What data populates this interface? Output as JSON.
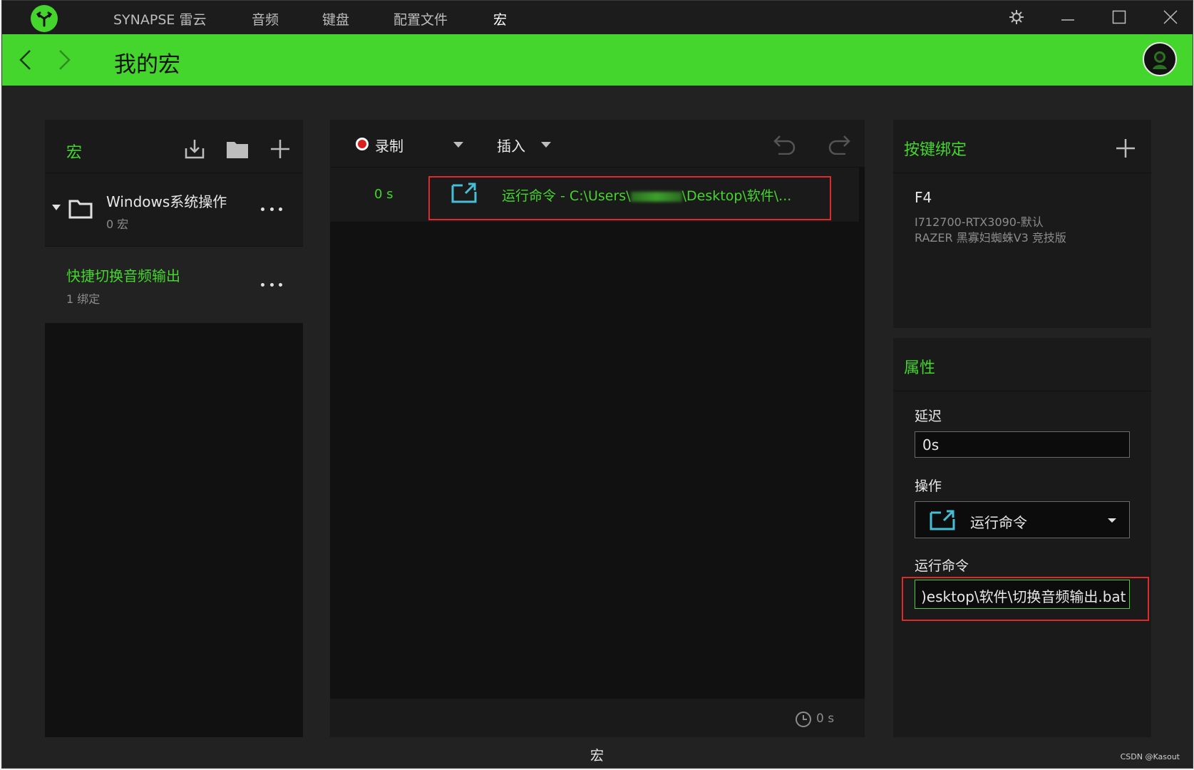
{
  "titlebar": {
    "nav": [
      "SYNAPSE 雷云",
      "音频",
      "键盘",
      "配置文件",
      "宏"
    ]
  },
  "header": {
    "title": "我的宏"
  },
  "macro_panel": {
    "title": "宏",
    "folder": {
      "name": "Windows系统操作",
      "count": "0 宏"
    },
    "macro": {
      "name": "快捷切换音频输出",
      "bindings": "1 绑定"
    }
  },
  "editor": {
    "record_label": "录制",
    "insert_label": "插入",
    "step": {
      "time": "0 s",
      "text_prefix": "运行命令 - C:\\Users\\",
      "text_suffix": "\\Desktop\\软件\\..."
    },
    "total_time": "0 s"
  },
  "bindings_panel": {
    "title": "按键绑定",
    "key": "F4",
    "device_line1": "I712700-RTX3090-默认",
    "device_line2": "RAZER 黑寡妇蜘蛛V3 竞技版"
  },
  "properties_panel": {
    "title": "属性",
    "delay_label": "延迟",
    "delay_value": "0s",
    "action_label": "操作",
    "action_value": "运行命令",
    "command_label": "运行命令",
    "command_value": ")esktop\\软件\\切换音频输出.bat"
  },
  "statusbar": {
    "label": "宏",
    "watermark": "CSDN @Kasout"
  },
  "colors": {
    "accent": "#44d62c",
    "highlight_box": "#e02a2a",
    "icon_teal": "#44bfd6"
  }
}
